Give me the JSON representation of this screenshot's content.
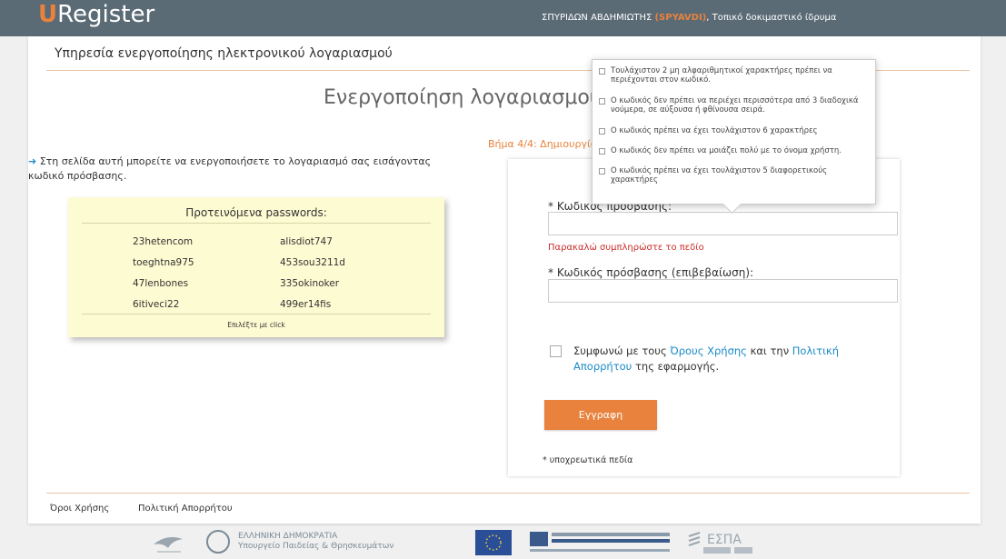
{
  "header": {
    "logo_initial": "U",
    "logo_rest": "Register",
    "user_name": "ΣΠΥΡΙΔΩΝ ΑΒΔΗΜΙΩΤΗΣ",
    "user_code": "(SPYAVDI)",
    "separator": ",",
    "institution": "Τοπικό δοκιμαστικό ίδρυμα"
  },
  "service_title": "Υπηρεσία ενεργοποίησης ηλεκτρονικού λογαριασμού",
  "page_title": "Ενεργοποίηση λογαριασμού",
  "step_label": "Βήμα 4/4: Δημιουργία κωδικού",
  "intro_text": "Στη σελίδα αυτή μπορείτε να ενεργοποιήσετε το λογαριασμό σας εισάγοντας κωδικό πρόσβασης.",
  "suggested": {
    "title": "Προτεινόμενα passwords:",
    "passwords": [
      [
        "23hetencom",
        "alisdiot747"
      ],
      [
        "toeghtna975",
        "453sou3211d"
      ],
      [
        "47lenbones",
        "335okinoker"
      ],
      [
        "6itiveci22",
        "499er14fis"
      ]
    ],
    "footer": "Επιλέξτε με click"
  },
  "form": {
    "password_label": "* Κωδικός πρόσβασης:",
    "password_value": "",
    "error_text": "Παρακαλώ συμπληρώστε το πεδίο",
    "confirm_label": "* Κωδικός πρόσβασης (επιβεβαίωση):",
    "confirm_value": "",
    "agree_prefix": "Συμφωνώ με τους ",
    "terms_link": "Όρους Χρήσης",
    "agree_middle": " και την ",
    "privacy_link": "Πολιτική Απορρήτου",
    "agree_suffix": " της εφαρμογής.",
    "agree_checked": false,
    "submit_label": "Εγγραφη",
    "required_note": "* υποχρεωτικά πεδία"
  },
  "tooltip_rules": [
    "Τουλάχιστον 2 μη αλφαριθμητικοί χαρακτήρες πρέπει να περιέχονται στον κωδικό.",
    "Ο κωδικός δεν πρέπει να περιέχει περισσότερα από 3 διαδοχικά νούμερα, σε αύξουσα ή φθίνουσα σειρά.",
    "Ο κωδικός πρέπει να έχει τουλάχιστον 6 χαρακτήρες",
    "Ο κωδικός δεν πρέπει να μοιάζει πολύ με το όνομα χρήστη.",
    "Ο κωδικός πρέπει να έχει τουλάχιστον 5 διαφορετικούς χαρακτήρες"
  ],
  "footer": {
    "terms_link": "Όροι Χρήσης",
    "privacy_link": "Πολιτική Απορρήτου",
    "ministry_line1": "ΕΛΛΗΝΙΚΗ ΔΗΜΟΚΡΑΤΙΑ",
    "ministry_line2": "Υπουργείο Παιδείας & Θρησκευμάτων",
    "espa_text": "ΕΣΠΑ"
  },
  "colors": {
    "accent": "#e8823d",
    "topbar": "#5b6b76",
    "link": "#1a8ac7",
    "error": "#c9302c",
    "suggest_bg": "#fdfbd2"
  }
}
